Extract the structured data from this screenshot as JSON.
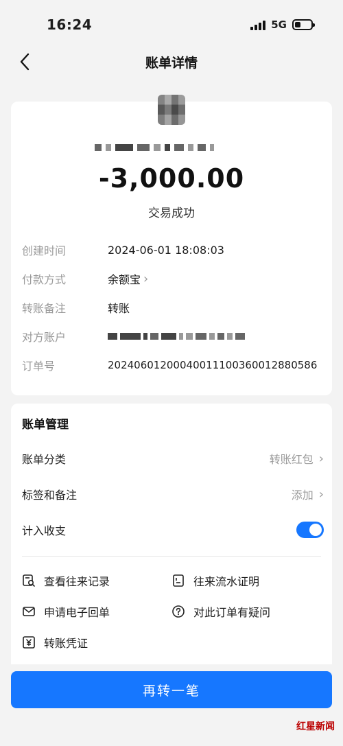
{
  "status_bar": {
    "time": "16:24",
    "network": "5G"
  },
  "nav": {
    "title": "账单详情"
  },
  "summary": {
    "amount": "-3,000.00",
    "status": "交易成功"
  },
  "details": [
    {
      "key": "创建时间",
      "value": "2024-06-01 18:08:03"
    },
    {
      "key": "付款方式",
      "value": "余额宝"
    },
    {
      "key": "转账备注",
      "value": "转账"
    },
    {
      "key": "对方账户",
      "value": ""
    },
    {
      "key": "订单号",
      "value": "20240601200040011100360012880586"
    }
  ],
  "management": {
    "title": "账单管理",
    "category_label": "账单分类",
    "category_value": "转账红包",
    "tags_label": "标签和备注",
    "tags_value": "添加",
    "include_label": "计入收支",
    "include_on": true
  },
  "links": {
    "history": "查看往来记录",
    "statement": "往来流水证明",
    "receipt": "申请电子回单",
    "question": "对此订单有疑问",
    "voucher": "转账凭证"
  },
  "cta": {
    "label": "再转一笔"
  },
  "watermark": {
    "brand": "红星新闻"
  },
  "colors": {
    "accent": "#1677ff",
    "label_gray": "#9a9a9a"
  }
}
